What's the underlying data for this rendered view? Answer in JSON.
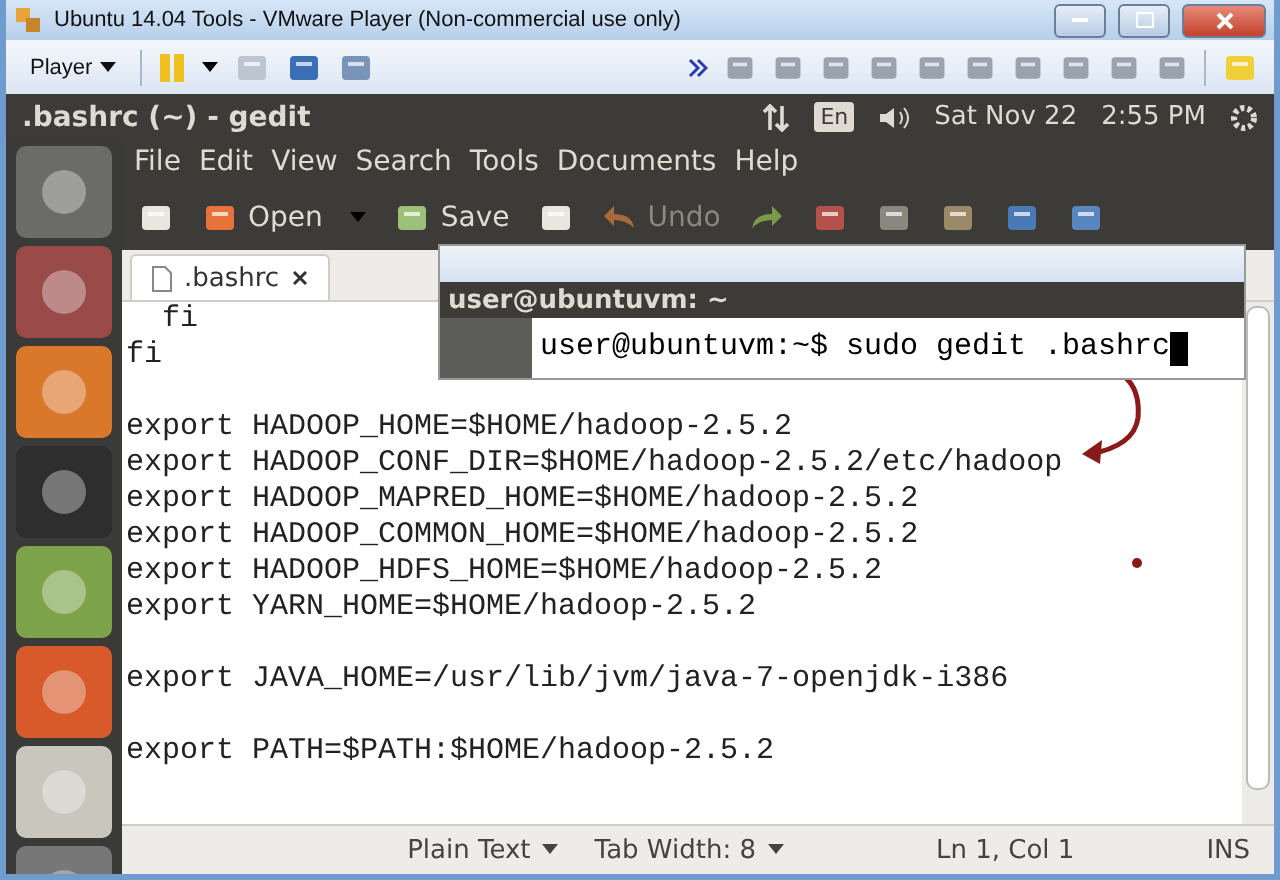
{
  "window": {
    "title": "Ubuntu 14.04 Tools - VMware Player (Non-commercial use only)"
  },
  "player_toolbar": {
    "menu": "Player"
  },
  "top_panel": {
    "title": ".bashrc (~) - gedit",
    "keyboard": "En",
    "date": "Sat Nov 22",
    "time": "2:55 PM"
  },
  "menu": [
    "File",
    "Edit",
    "View",
    "Search",
    "Tools",
    "Documents",
    "Help"
  ],
  "toolbar": {
    "open": {
      "label": "Open"
    },
    "save": {
      "label": "Save"
    },
    "undo": {
      "label": "Undo",
      "disabled": true
    }
  },
  "tabs": [
    {
      "label": ".bashrc",
      "selected": true
    }
  ],
  "editor_blocks": [
    [
      "  fi",
      "fi"
    ],
    [
      "export HADOOP_HOME=$HOME/hadoop-2.5.2",
      "export HADOOP_CONF_DIR=$HOME/hadoop-2.5.2/etc/hadoop",
      "export HADOOP_MAPRED_HOME=$HOME/hadoop-2.5.2",
      "export HADOOP_COMMON_HOME=$HOME/hadoop-2.5.2",
      "export HADOOP_HDFS_HOME=$HOME/hadoop-2.5.2",
      "export YARN_HOME=$HOME/hadoop-2.5.2"
    ],
    [
      "export JAVA_HOME=/usr/lib/jvm/java-7-openjdk-i386"
    ],
    [
      "export PATH=$PATH:$HOME/hadoop-2.5.2"
    ]
  ],
  "terminal": {
    "title": "user@ubuntuvm: ~",
    "command": "user@ubuntuvm:~$ sudo gedit .bashrc"
  },
  "status_bar": {
    "language": "Plain Text",
    "tab_width": "Tab Width: 8",
    "position": "Ln 1, Col 1",
    "mode": "INS"
  }
}
